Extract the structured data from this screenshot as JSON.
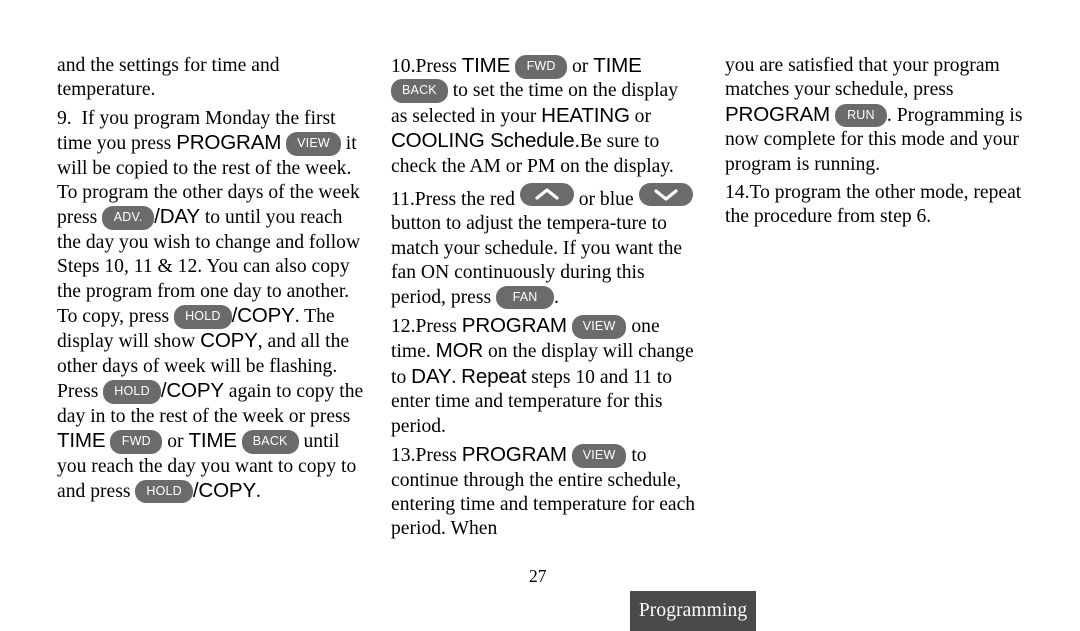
{
  "document": {
    "page_number": "27",
    "section_tab_label": "Programming",
    "pill_color": "#6b6b6b",
    "tab_color": "#4a4a4a"
  },
  "buttons": {
    "view": "VIEW",
    "adv": "ADV.",
    "hold": "HOLD",
    "fwd": "FWD",
    "back": "BACK",
    "fan": "FAN",
    "run": "RUN",
    "up_arrow": "up-arrow-button",
    "down_arrow": "down-arrow-button"
  },
  "column1": {
    "para_continued": {
      "t1": "and the settings for time and temperature."
    },
    "step9": {
      "number": "9.",
      "t1": "If you program Monday the first time you press ",
      "program": "PROGRAM",
      "t2": " it will be copied to the rest of the week. To program the other days of the week press ",
      "day": "/DAY",
      "t3": " to until you reach the day you wish to change and follow Steps 10, 11 & 12. You can also copy the program from one day to another. To copy, press ",
      "copy1": "/COPY",
      "t4": ". The display will show ",
      "copy2": "COPY",
      "t5": ", and all the other days of week will be flashing. Press ",
      "copy3": "/COPY",
      "t6": " again to copy the day in to the rest of the week or press ",
      "time1": "TIME",
      "t7": " or ",
      "time2": "TIME",
      "t8": " until you reach the day you want to copy to and press ",
      "copy4": "/COPY",
      "t9": "."
    }
  },
  "column2": {
    "step10": {
      "number": "10.",
      "t1": "Press ",
      "time1": "TIME",
      "t2": " or ",
      "time2": "TIME",
      "t3": " to set the time on the display as selected in your ",
      "heating": "HEATING",
      "t4": " or ",
      "cooling": "COOLING Schedule.",
      "t5": "Be sure to check the AM or PM on the display."
    },
    "step11": {
      "number": "11.",
      "t1": "Press the red ",
      "t2": " or blue ",
      "t3": " button to adjust the tempera-ture to match your schedule. If you want the fan ON continuously during this period, press ",
      "t4": "."
    },
    "step12": {
      "number": "12.",
      "t1": "Press ",
      "program": "PROGRAM",
      "t2": " one time. ",
      "mor": "MOR",
      "t3": " on the display will change to ",
      "day": "DAY",
      "t4": ". ",
      "repeat": "Repeat",
      "t5": " steps 10 and 11 to enter time and temperature for this period."
    },
    "step13": {
      "number": "13.",
      "t1": "Press ",
      "program": "PROGRAM",
      "t2": " to continue through the entire schedule, entering time and temperature for each period. When"
    }
  },
  "column3": {
    "step13_cont": {
      "t1": "you are satisfied that your program matches your schedule, press ",
      "program": "PROGRAM",
      "t2": ". Programming is now complete for this mode and your program is running."
    },
    "step14": {
      "number": "14.",
      "t1": "To program the other mode, repeat the procedure from step 6."
    }
  }
}
